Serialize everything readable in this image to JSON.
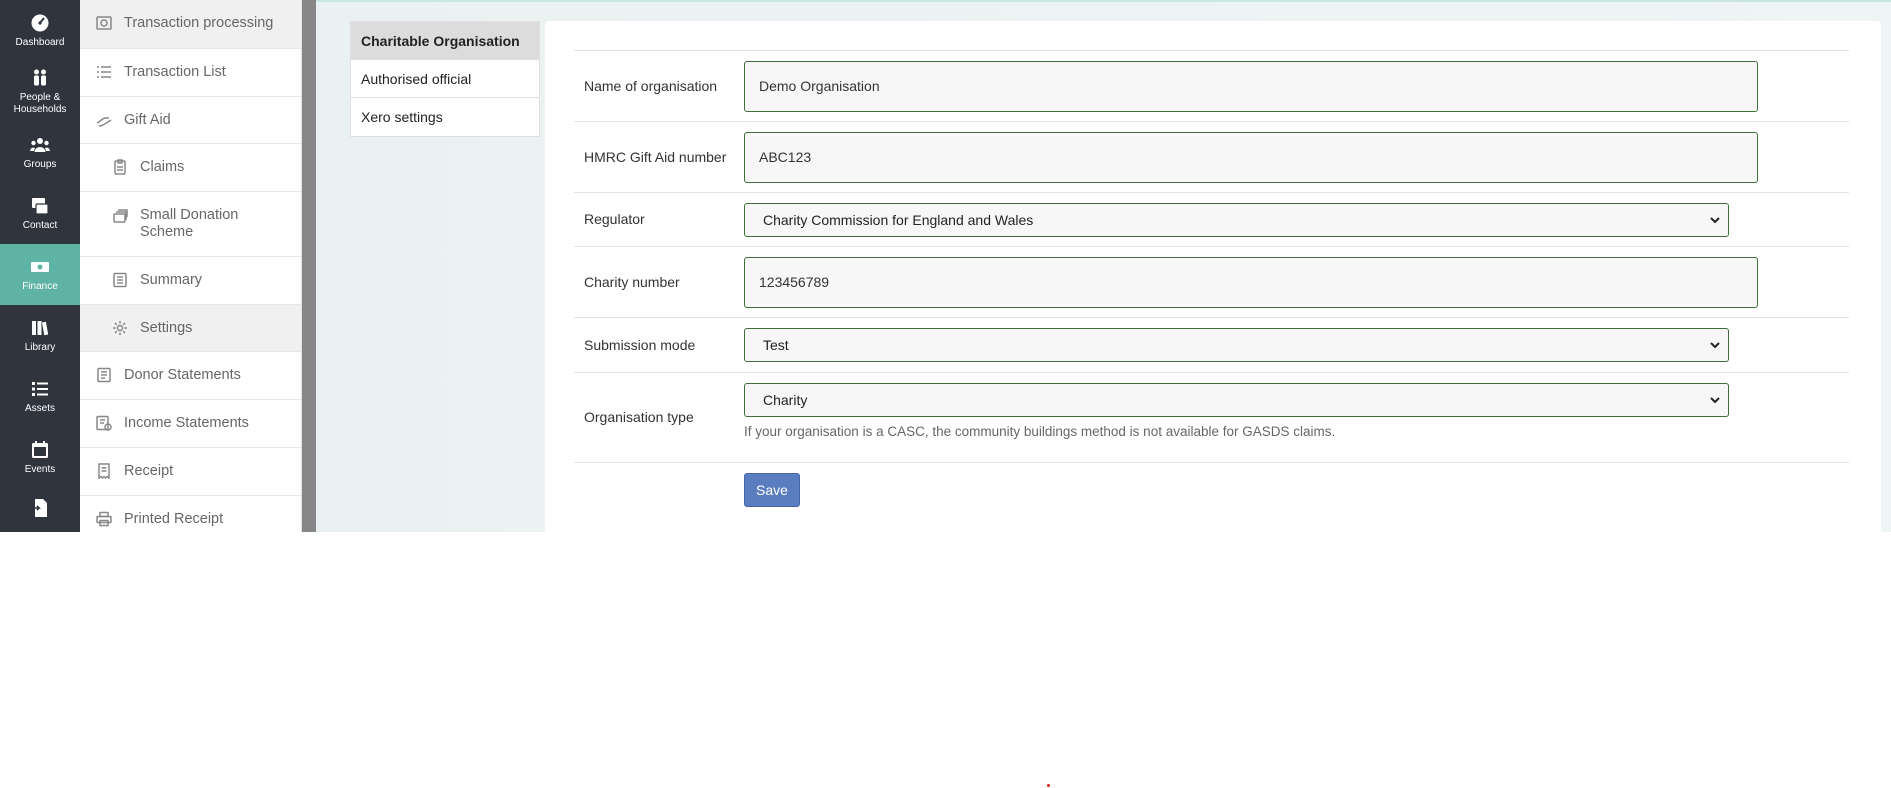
{
  "rail": [
    {
      "label": "Dashboard",
      "icon": "dashboard-icon"
    },
    {
      "label": "People & Households",
      "icon": "people-icon"
    },
    {
      "label": "Groups",
      "icon": "groups-icon"
    },
    {
      "label": "Contact",
      "icon": "contact-icon"
    },
    {
      "label": "Finance",
      "icon": "finance-icon",
      "active": true
    },
    {
      "label": "Library",
      "icon": "library-icon"
    },
    {
      "label": "Assets",
      "icon": "assets-icon"
    },
    {
      "label": "Events",
      "icon": "events-icon"
    },
    {
      "label": "",
      "icon": "import-icon"
    }
  ],
  "submenu": [
    {
      "label": "Transaction processing",
      "icon": "transaction-processing-icon"
    },
    {
      "label": "Transaction List",
      "icon": "list-icon"
    },
    {
      "label": "Gift Aid",
      "icon": "gift-aid-icon"
    },
    {
      "label": "Claims",
      "icon": "clipboard-icon"
    },
    {
      "label": "Small Donation Scheme",
      "icon": "stack-icon"
    },
    {
      "label": "Summary",
      "icon": "summary-icon"
    },
    {
      "label": "Settings",
      "icon": "gear-icon"
    },
    {
      "label": "Donor Statements",
      "icon": "document-icon"
    },
    {
      "label": "Income Statements",
      "icon": "income-statement-icon"
    },
    {
      "label": "Receipt",
      "icon": "receipt-icon"
    },
    {
      "label": "Printed Receipt",
      "icon": "printer-icon"
    }
  ],
  "tabs": [
    "Charitable Organisation",
    "Authorised official",
    "Xero settings"
  ],
  "form": {
    "name_label": "Name of organisation",
    "name_value": "Demo Organisation",
    "hmrc_label": "HMRC Gift Aid number",
    "hmrc_value": "ABC123",
    "regulator_label": "Regulator",
    "regulator_value": "Charity Commission for England and Wales",
    "charity_label": "Charity number",
    "charity_value": "123456789",
    "mode_label": "Submission mode",
    "mode_value": "Test",
    "orgtype_label": "Organisation type",
    "orgtype_value": "Charity",
    "orgtype_help": "If your organisation is a CASC, the community buildings method is not available for GASDS claims.",
    "save_label": "Save"
  },
  "colors": {
    "rail_bg": "#2f343d",
    "rail_active": "#5fb3a4",
    "input_border": "#3f6e3a",
    "save_button": "#5a7dc0"
  }
}
